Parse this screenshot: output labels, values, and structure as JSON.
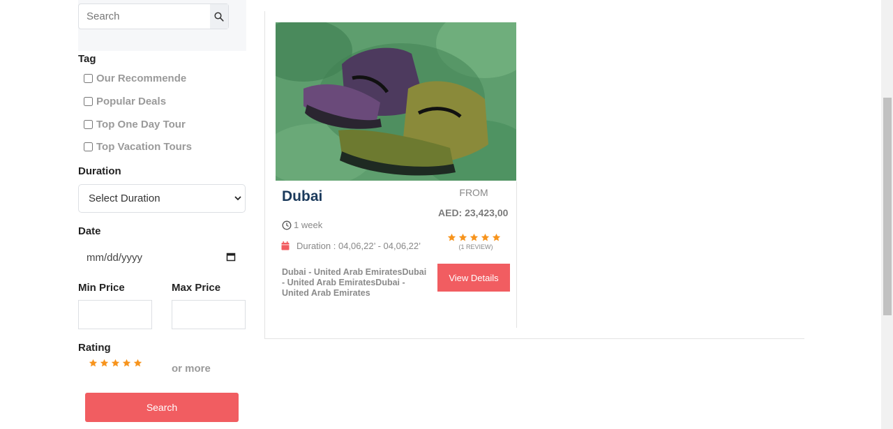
{
  "search": {
    "placeholder": "Search"
  },
  "filters": {
    "tag_title": "Tag",
    "tags": [
      "Our Recommende",
      "Popular Deals",
      "Top One Day Tour",
      "Top Vacation Tours"
    ],
    "duration_title": "Duration",
    "duration_selected": "Select Duration",
    "date_title": "Date",
    "date_placeholder": "mm/dd/yyyy",
    "min_price_title": "Min Price",
    "max_price_title": "Max Price",
    "rating_title": "Rating",
    "rating_stars": 5,
    "rating_suffix": "or more",
    "search_button": "Search"
  },
  "card": {
    "title": "Dubai",
    "from_label": "FROM",
    "price": "AED: 23,423,00",
    "duration_short": "1 week",
    "duration_range": "Duration : 04,06,22’ - 04,06,22’",
    "stars": 5,
    "reviews": "(1 REVIEW)",
    "location": "Dubai - United Arab EmiratesDubai - United Arab EmiratesDubai - United Arab Emirates",
    "view_button": "View Details"
  },
  "colors": {
    "accent": "#f15d61",
    "star": "#f7941d",
    "title": "#1b3a5c"
  },
  "icons": [
    "search-icon",
    "chevron-down-icon",
    "calendar-icon",
    "clock-icon",
    "star-icon"
  ]
}
